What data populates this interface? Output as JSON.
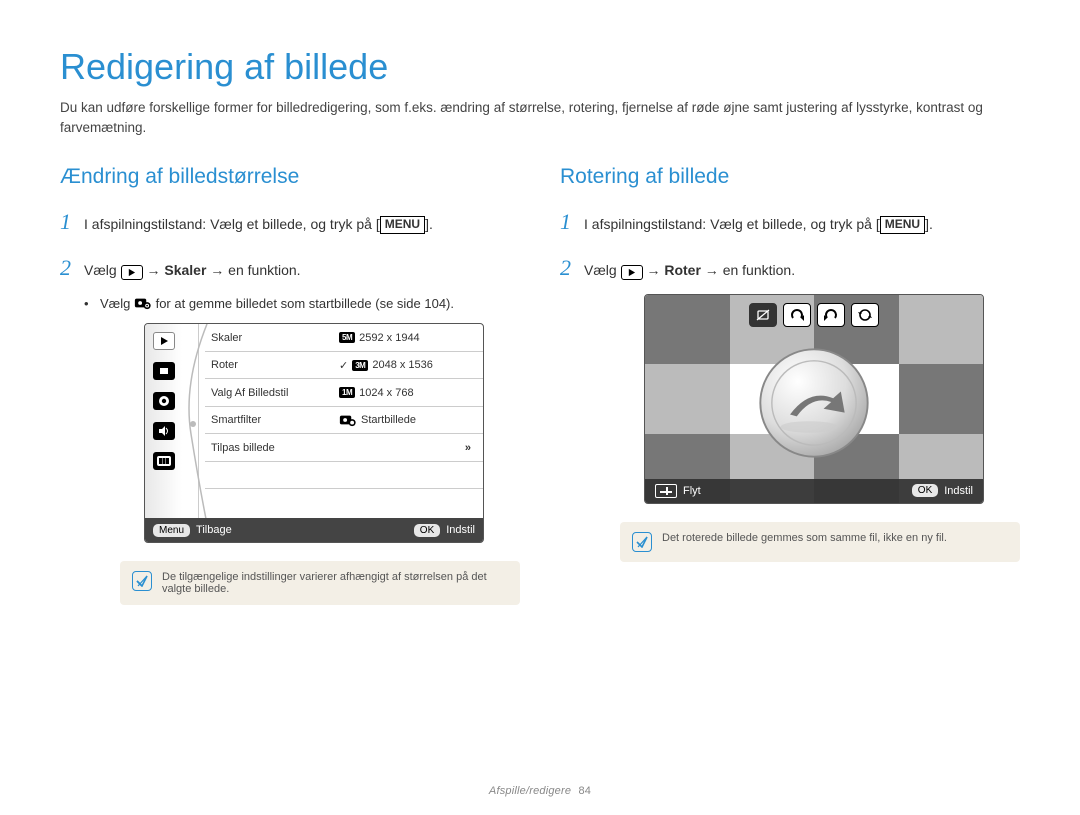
{
  "title": "Redigering af billede",
  "intro": "Du kan udføre forskellige former for billedredigering, som f.eks. ændring af størrelse, rotering, fjernelse af røde øjne samt justering af lysstyrke, kontrast og farvemætning.",
  "left": {
    "heading": "Ændring af billedstørrelse",
    "step1_pre": "I afspilningstilstand: Vælg et billede, og tryk på [",
    "step1_menu": "MENU",
    "step1_post": "].",
    "step2_pre": "Vælg ",
    "step2_arrow1": " → ",
    "step2_bold": "Skaler",
    "step2_arrow2": " → en funktion.",
    "bullet_pre": "Vælg ",
    "bullet_post": " for at gemme billedet som startbillede (se side 104).",
    "cam": {
      "rows": [
        {
          "l": "Skaler",
          "sel": true,
          "badge": "5M",
          "val": "2592 x 1944"
        },
        {
          "l": "Roter",
          "check": true,
          "badge": "3M",
          "val": "2048 x 1536"
        },
        {
          "l": "Valg Af Billedstil",
          "badge": "1M",
          "val": "1024 x 768"
        },
        {
          "l": "Smartfilter",
          "starticon": true,
          "val": "Startbillede"
        },
        {
          "l": "Tilpas billede",
          "more": true
        }
      ],
      "footer_back_pill": "Menu",
      "footer_back": "Tilbage",
      "footer_ok_pill": "OK",
      "footer_ok": "Indstil"
    },
    "note": "De tilgængelige indstillinger varierer afhængigt af størrelsen på det valgte billede."
  },
  "right": {
    "heading": "Rotering af billede",
    "step1_pre": "I afspilningstilstand: Vælg et billede, og tryk på [",
    "step1_menu": "MENU",
    "step1_post": "].",
    "step2_pre": "Vælg ",
    "step2_arrow1": " → ",
    "step2_bold": "Roter",
    "step2_arrow2": " → en funktion.",
    "cam": {
      "footer_move": "Flyt",
      "footer_ok_pill": "OK",
      "footer_ok": "Indstil"
    },
    "note": "Det roterede billede gemmes som samme fil, ikke en ny fil."
  },
  "footer": {
    "section": "Afspille/redigere",
    "page": "84"
  }
}
